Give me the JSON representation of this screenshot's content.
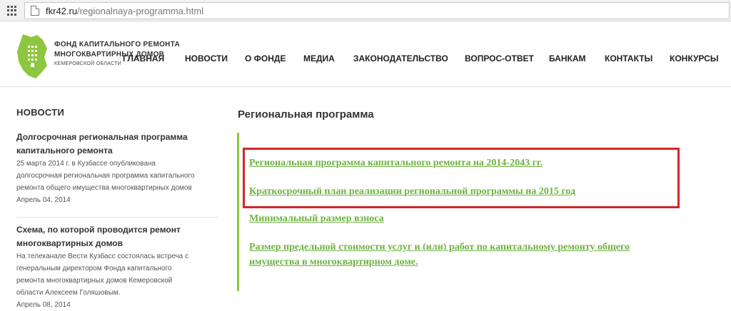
{
  "browser": {
    "url_domain": "fkr42.ru",
    "url_path": "/regionalnaya-programma.html"
  },
  "header": {
    "brand_line1": "ФОНД КАПИТАЛЬНОГО РЕМОНТА",
    "brand_line2": "МНОГОКВАРТИРНЫХ ДОМОВ",
    "brand_line3": "КЕМЕРОВСКОЙ ОБЛАСТИ",
    "nav": [
      "ГЛАВНАЯ",
      "НОВОСТИ",
      "О ФОНДЕ",
      "МЕДИА",
      "ЗАКОНОДАТЕЛЬСТВО",
      "ВОПРОС-ОТВЕТ",
      "БАНКАМ",
      "КОНТАКТЫ",
      "КОНКУРСЫ"
    ]
  },
  "sidebar": {
    "title": "НОВОСТИ",
    "news": [
      {
        "title_line1": "Долгосрочная региональная программа",
        "title_line2": "капитального ремонта",
        "text_lines": [
          "25 марта 2014 г. в Кузбассе опубликована",
          "долгосрочная региональная программа капитального",
          "ремонта общего имущества многоквартирных домов"
        ],
        "date": "Апрель 04, 2014"
      },
      {
        "title_line1": "Схема, по которой проводится ремонт",
        "title_line2": "многоквартирных домов",
        "text_lines": [
          "На телеканале Вести Кузбасс состоялась встреча с",
          "генеральным директором Фонда капитального",
          "ремонта многоквартирных домов Кемеровской",
          "области Алексеем Голяшовым."
        ],
        "date": "Апрель 08, 2014"
      }
    ]
  },
  "main": {
    "title": "Региональная программа",
    "links": [
      "Региональная программа капитального ремонта на 2014-2043 гг.",
      "Краткосрочный план реализации региональной программы на 2015 год",
      "Минимальный размер взноса",
      "Размер предельной стоимости услуг и (или) работ по капитальному ремонту общего",
      "имущества в многоквартирном доме."
    ]
  },
  "colors": {
    "link_green": "#6db33f",
    "accent_green": "#8dc63f",
    "highlight_red": "#d3252a"
  }
}
